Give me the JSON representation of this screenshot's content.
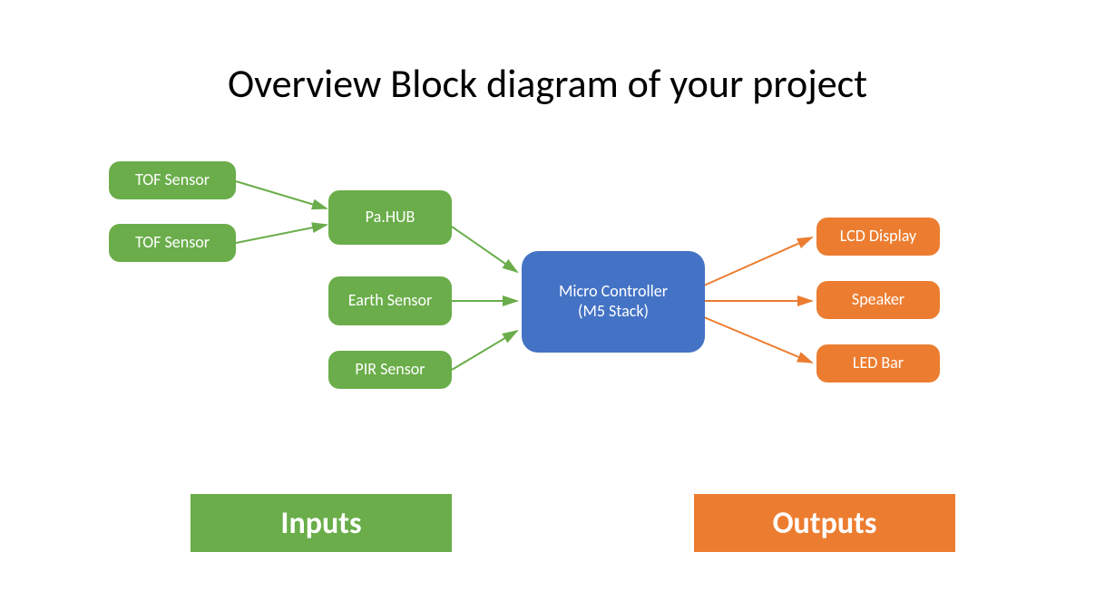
{
  "title": "Overview Block diagram of your project",
  "blocks": {
    "tof1": "TOF Sensor",
    "tof2": "TOF Sensor",
    "pahub": "Pa.HUB",
    "earth": "Earth Sensor",
    "pir": "PIR Sensor",
    "micro_line1": "Micro Controller",
    "micro_line2": "(M5 Stack)",
    "lcd": "LCD Display",
    "speaker": "Speaker",
    "ledbar": "LED Bar"
  },
  "legend": {
    "inputs": "Inputs",
    "outputs": "Outputs"
  },
  "colors": {
    "green": "#6aad4a",
    "blue": "#4473c5",
    "orange": "#ec7d30"
  }
}
